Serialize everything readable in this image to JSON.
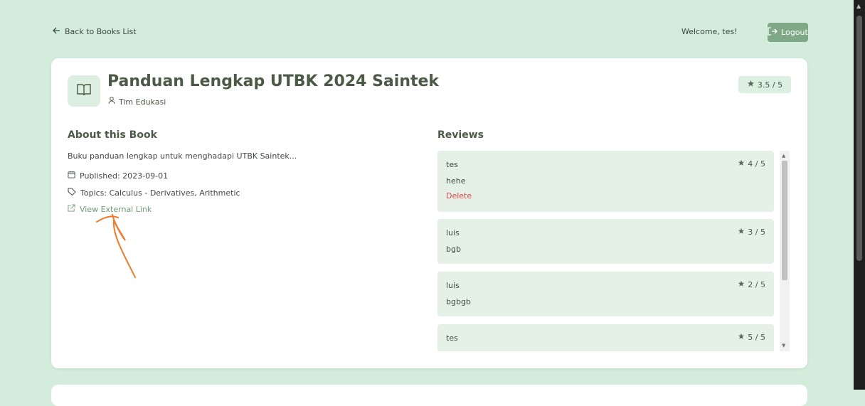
{
  "header": {
    "back_label": "Back to Books List",
    "welcome": "Welcome, tes!",
    "logout_label": "Logout"
  },
  "book": {
    "title": "Panduan Lengkap UTBK 2024 Saintek",
    "author": "Tim Edukasi",
    "rating": "3.5 / 5",
    "about_heading": "About this Book",
    "description": "Buku panduan lengkap untuk menghadapi UTBK Saintek...",
    "published": "Published: 2023-09-01",
    "topics": "Topics: Calculus - Derivatives, Arithmetic",
    "external_link": "View External Link"
  },
  "reviews": {
    "heading": "Reviews",
    "items": [
      {
        "user": "tes",
        "rating": "4 / 5",
        "comment": "hehe",
        "delete": "Delete"
      },
      {
        "user": "luis",
        "rating": "3 / 5",
        "comment": "bgb"
      },
      {
        "user": "luis",
        "rating": "2 / 5",
        "comment": "bgbgb"
      },
      {
        "user": "tes",
        "rating": "5 / 5",
        "comment": ""
      }
    ]
  },
  "colors": {
    "page_bg": "#d4ecdb",
    "accent": "#7fa886",
    "delete": "#e04646"
  }
}
